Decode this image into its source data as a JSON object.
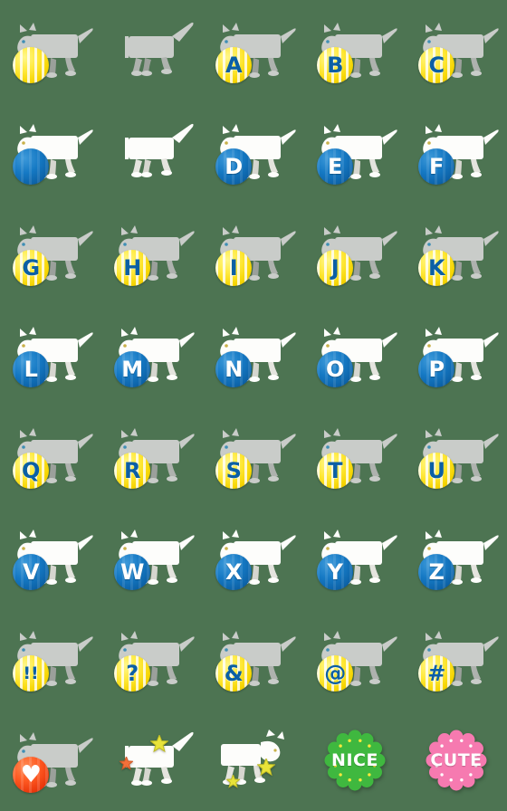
{
  "background_color": "#4d7452",
  "palette": {
    "ball_yellow": "#ffe93c",
    "ball_yellow_letter": "#0b5fa5",
    "ball_blue": "#1579c4",
    "ball_blue_letter": "#ffffff",
    "ball_red": "#ff5a22",
    "cat_gray": "#c9ccc9",
    "cat_white": "#fdfdfb",
    "badge_green": "#3fb83f",
    "badge_green_dot": "#ffe93c",
    "badge_pink": "#f67ab0",
    "badge_pink_dot": "#ffffff",
    "star_yellow": "#e8e33a",
    "star_orange": "#f4703a"
  },
  "grid": {
    "columns": 5,
    "rows": 8,
    "cell_size": 112
  },
  "stickers": [
    {
      "id": "r1c1",
      "row": 1,
      "col": 1,
      "cat": "gray",
      "pose": "ball",
      "item": "ball",
      "ball_color": "yellow",
      "glyph": "",
      "label": "gray-cat-with-yellow-striped-ball"
    },
    {
      "id": "r1c2",
      "row": 1,
      "col": 2,
      "cat": "gray",
      "pose": "pounce",
      "item": "none",
      "ball_color": "",
      "glyph": "",
      "label": "gray-cat-pouncing"
    },
    {
      "id": "r1c3",
      "row": 1,
      "col": 3,
      "cat": "gray",
      "pose": "ball",
      "item": "ball",
      "ball_color": "yellow",
      "glyph": "A",
      "label": "gray-cat-with-letter-a-ball"
    },
    {
      "id": "r1c4",
      "row": 1,
      "col": 4,
      "cat": "gray",
      "pose": "ball",
      "item": "ball",
      "ball_color": "yellow",
      "glyph": "B",
      "label": "gray-cat-with-letter-b-ball"
    },
    {
      "id": "r1c5",
      "row": 1,
      "col": 5,
      "cat": "gray",
      "pose": "ball",
      "item": "ball",
      "ball_color": "yellow",
      "glyph": "C",
      "label": "gray-cat-with-letter-c-ball"
    },
    {
      "id": "r2c1",
      "row": 2,
      "col": 1,
      "cat": "white",
      "pose": "ball",
      "item": "ball",
      "ball_color": "blue",
      "glyph": "",
      "label": "white-cat-with-blue-ball"
    },
    {
      "id": "r2c2",
      "row": 2,
      "col": 2,
      "cat": "white",
      "pose": "pounce",
      "item": "none",
      "ball_color": "",
      "glyph": "",
      "label": "white-cat-pouncing"
    },
    {
      "id": "r2c3",
      "row": 2,
      "col": 3,
      "cat": "white",
      "pose": "ball",
      "item": "ball",
      "ball_color": "blue",
      "glyph": "D",
      "label": "white-cat-with-letter-d-ball"
    },
    {
      "id": "r2c4",
      "row": 2,
      "col": 4,
      "cat": "white",
      "pose": "ball",
      "item": "ball",
      "ball_color": "blue",
      "glyph": "E",
      "label": "white-cat-with-letter-e-ball"
    },
    {
      "id": "r2c5",
      "row": 2,
      "col": 5,
      "cat": "white",
      "pose": "ball",
      "item": "ball",
      "ball_color": "blue",
      "glyph": "F",
      "label": "white-cat-with-letter-f-ball"
    },
    {
      "id": "r3c1",
      "row": 3,
      "col": 1,
      "cat": "gray",
      "pose": "ball",
      "item": "ball",
      "ball_color": "yellow",
      "glyph": "G",
      "label": "gray-cat-with-letter-g-ball"
    },
    {
      "id": "r3c2",
      "row": 3,
      "col": 2,
      "cat": "gray",
      "pose": "ball",
      "item": "ball",
      "ball_color": "yellow",
      "glyph": "H",
      "label": "gray-cat-with-letter-h-ball"
    },
    {
      "id": "r3c3",
      "row": 3,
      "col": 3,
      "cat": "gray",
      "pose": "ball",
      "item": "ball",
      "ball_color": "yellow",
      "glyph": "I",
      "label": "gray-cat-with-letter-i-ball"
    },
    {
      "id": "r3c4",
      "row": 3,
      "col": 4,
      "cat": "gray",
      "pose": "ball",
      "item": "ball",
      "ball_color": "yellow",
      "glyph": "J",
      "label": "gray-cat-with-letter-j-ball"
    },
    {
      "id": "r3c5",
      "row": 3,
      "col": 5,
      "cat": "gray",
      "pose": "ball",
      "item": "ball",
      "ball_color": "yellow",
      "glyph": "K",
      "label": "gray-cat-with-letter-k-ball"
    },
    {
      "id": "r4c1",
      "row": 4,
      "col": 1,
      "cat": "white",
      "pose": "ball",
      "item": "ball",
      "ball_color": "blue",
      "glyph": "L",
      "label": "white-cat-with-letter-l-ball"
    },
    {
      "id": "r4c2",
      "row": 4,
      "col": 2,
      "cat": "white",
      "pose": "ball",
      "item": "ball",
      "ball_color": "blue",
      "glyph": "M",
      "label": "white-cat-with-letter-m-ball"
    },
    {
      "id": "r4c3",
      "row": 4,
      "col": 3,
      "cat": "white",
      "pose": "ball",
      "item": "ball",
      "ball_color": "blue",
      "glyph": "N",
      "label": "white-cat-with-letter-n-ball"
    },
    {
      "id": "r4c4",
      "row": 4,
      "col": 4,
      "cat": "white",
      "pose": "ball",
      "item": "ball",
      "ball_color": "blue",
      "glyph": "O",
      "label": "white-cat-with-letter-o-ball"
    },
    {
      "id": "r4c5",
      "row": 4,
      "col": 5,
      "cat": "white",
      "pose": "ball",
      "item": "ball",
      "ball_color": "blue",
      "glyph": "P",
      "label": "white-cat-with-letter-p-ball"
    },
    {
      "id": "r5c1",
      "row": 5,
      "col": 1,
      "cat": "gray",
      "pose": "ball",
      "item": "ball",
      "ball_color": "yellow",
      "glyph": "Q",
      "label": "gray-cat-with-letter-q-ball"
    },
    {
      "id": "r5c2",
      "row": 5,
      "col": 2,
      "cat": "gray",
      "pose": "ball",
      "item": "ball",
      "ball_color": "yellow",
      "glyph": "R",
      "label": "gray-cat-with-letter-r-ball"
    },
    {
      "id": "r5c3",
      "row": 5,
      "col": 3,
      "cat": "gray",
      "pose": "ball",
      "item": "ball",
      "ball_color": "yellow",
      "glyph": "S",
      "label": "gray-cat-with-letter-s-ball"
    },
    {
      "id": "r5c4",
      "row": 5,
      "col": 4,
      "cat": "gray",
      "pose": "ball",
      "item": "ball",
      "ball_color": "yellow",
      "glyph": "T",
      "label": "gray-cat-with-letter-t-ball"
    },
    {
      "id": "r5c5",
      "row": 5,
      "col": 5,
      "cat": "gray",
      "pose": "ball",
      "item": "ball",
      "ball_color": "yellow",
      "glyph": "U",
      "label": "gray-cat-with-letter-u-ball"
    },
    {
      "id": "r6c1",
      "row": 6,
      "col": 1,
      "cat": "white",
      "pose": "ball",
      "item": "ball",
      "ball_color": "blue",
      "glyph": "V",
      "label": "white-cat-with-letter-v-ball"
    },
    {
      "id": "r6c2",
      "row": 6,
      "col": 2,
      "cat": "white",
      "pose": "ball",
      "item": "ball",
      "ball_color": "blue",
      "glyph": "W",
      "label": "white-cat-with-letter-w-ball"
    },
    {
      "id": "r6c3",
      "row": 6,
      "col": 3,
      "cat": "white",
      "pose": "ball",
      "item": "ball",
      "ball_color": "blue",
      "glyph": "X",
      "label": "white-cat-with-letter-x-ball"
    },
    {
      "id": "r6c4",
      "row": 6,
      "col": 4,
      "cat": "white",
      "pose": "ball",
      "item": "ball",
      "ball_color": "blue",
      "glyph": "Y",
      "label": "white-cat-with-letter-y-ball"
    },
    {
      "id": "r6c5",
      "row": 6,
      "col": 5,
      "cat": "white",
      "pose": "ball",
      "item": "ball",
      "ball_color": "blue",
      "glyph": "Z",
      "label": "white-cat-with-letter-z-ball"
    },
    {
      "id": "r7c1",
      "row": 7,
      "col": 1,
      "cat": "gray",
      "pose": "ball",
      "item": "ball",
      "ball_color": "yellow",
      "glyph": "!!",
      "label": "gray-cat-with-double-exclamation-ball"
    },
    {
      "id": "r7c2",
      "row": 7,
      "col": 2,
      "cat": "gray",
      "pose": "ball",
      "item": "ball",
      "ball_color": "yellow",
      "glyph": "?",
      "label": "gray-cat-with-question-mark-ball"
    },
    {
      "id": "r7c3",
      "row": 7,
      "col": 3,
      "cat": "gray",
      "pose": "ball",
      "item": "ball",
      "ball_color": "yellow",
      "glyph": "&",
      "label": "gray-cat-with-ampersand-ball"
    },
    {
      "id": "r7c4",
      "row": 7,
      "col": 4,
      "cat": "gray",
      "pose": "ball",
      "item": "ball",
      "ball_color": "yellow",
      "glyph": "@",
      "label": "gray-cat-with-at-sign-ball"
    },
    {
      "id": "r7c5",
      "row": 7,
      "col": 5,
      "cat": "gray",
      "pose": "ball",
      "item": "ball",
      "ball_color": "yellow",
      "glyph": "#",
      "label": "gray-cat-with-hash-ball"
    },
    {
      "id": "r8c1",
      "row": 8,
      "col": 1,
      "cat": "gray",
      "pose": "ball",
      "item": "ball",
      "ball_color": "red",
      "glyph": "♥",
      "label": "gray-cat-with-heart-ball"
    },
    {
      "id": "r8c2",
      "row": 8,
      "col": 2,
      "cat": "white",
      "pose": "pounce",
      "item": "stars",
      "ball_color": "",
      "glyph": "",
      "label": "white-cat-pouncing-with-stars"
    },
    {
      "id": "r8c3",
      "row": 8,
      "col": 3,
      "cat": "white",
      "pose": "walk",
      "item": "stars",
      "ball_color": "",
      "glyph": "",
      "label": "white-cat-walking-with-stars"
    },
    {
      "id": "r8c4",
      "row": 8,
      "col": 4,
      "cat": "none",
      "pose": "badge",
      "item": "badge",
      "ball_color": "",
      "glyph": "",
      "badge_text": "NICE",
      "badge_style": "green",
      "label": "nice-badge"
    },
    {
      "id": "r8c5",
      "row": 8,
      "col": 5,
      "cat": "none",
      "pose": "badge",
      "item": "badge",
      "ball_color": "",
      "glyph": "",
      "badge_text": "CUTE",
      "badge_style": "pink",
      "label": "cute-badge"
    }
  ]
}
